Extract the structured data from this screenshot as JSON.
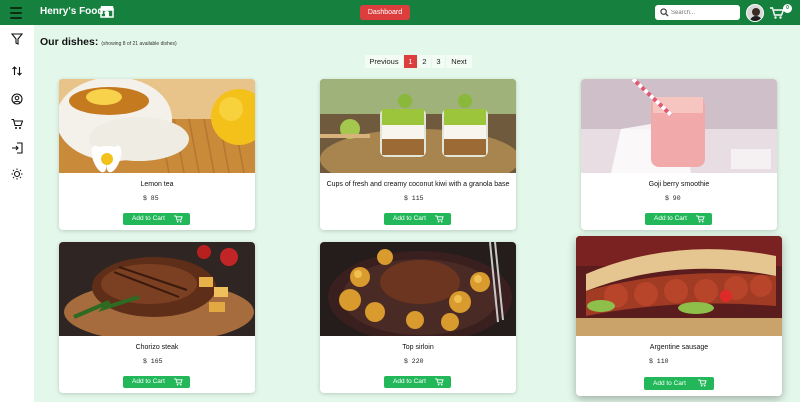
{
  "header": {
    "brand": "Henry's Foods",
    "dashboard_label": "Dashboard",
    "search_placeholder": "Search...",
    "cart_count": "0"
  },
  "main": {
    "heading": "Our dishes:",
    "subheading": "(showing 8 of 21 available dishes)"
  },
  "pagination": {
    "previous": "Previous",
    "pages": [
      "1",
      "2",
      "3"
    ],
    "active_page": "1",
    "next": "Next"
  },
  "dishes": [
    {
      "name": "Lemon tea",
      "price": "$ 85",
      "button": "Add to Cart"
    },
    {
      "name": "Cups of fresh and creamy coconut kiwi with a granola base",
      "price": "$ 115",
      "button": "Add to Cart"
    },
    {
      "name": "Goji berry smoothie",
      "price": "$ 90",
      "button": "Add to Cart"
    },
    {
      "name": "Chorizo steak",
      "price": "$ 165",
      "button": "Add to Cart"
    },
    {
      "name": "Top sirloin",
      "price": "$ 220",
      "button": "Add to Cart"
    },
    {
      "name": "Argentine sausage",
      "price": "$ 110",
      "button": "Add to Cart"
    }
  ],
  "sidebar": {
    "icons": [
      "filter-icon",
      "sort-icon",
      "user-icon",
      "cart-icon",
      "login-icon",
      "theme-icon"
    ]
  },
  "colors": {
    "topbar": "#16813f",
    "background": "#e3f8ea",
    "accent_red": "#dc3e3e",
    "button_green": "#22b85a"
  }
}
